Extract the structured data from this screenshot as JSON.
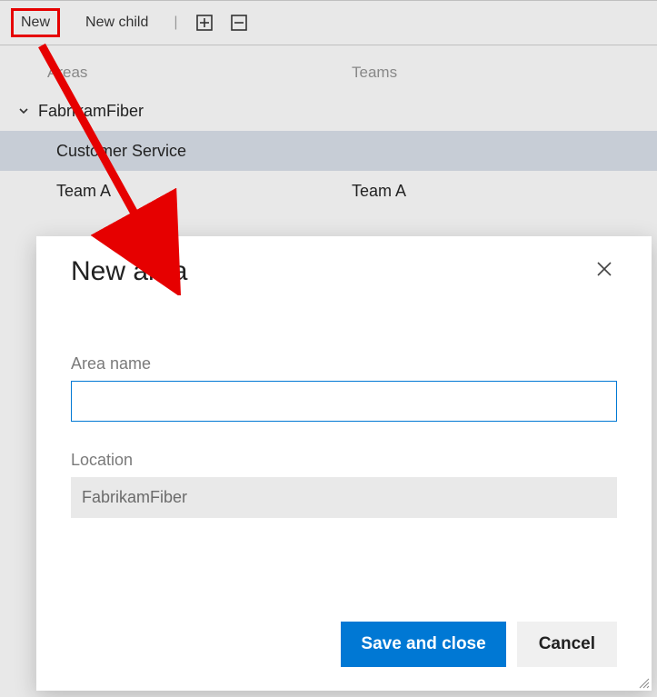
{
  "toolbar": {
    "new_label": "New",
    "new_child_label": "New child"
  },
  "columns": {
    "areas": "Areas",
    "teams": "Teams"
  },
  "tree": {
    "root": {
      "name": "FabrikamFiber",
      "team": ""
    },
    "children": [
      {
        "name": "Customer Service",
        "team": ""
      },
      {
        "name": "Team A",
        "team": "Team A"
      }
    ]
  },
  "dialog": {
    "title": "New area",
    "area_name_label": "Area name",
    "area_name_value": "",
    "location_label": "Location",
    "location_value": "FabrikamFiber",
    "save_label": "Save and close",
    "cancel_label": "Cancel"
  },
  "colors": {
    "accent": "#0078d4",
    "highlight_border": "#e60000",
    "selected_row": "#c7cdd6"
  }
}
